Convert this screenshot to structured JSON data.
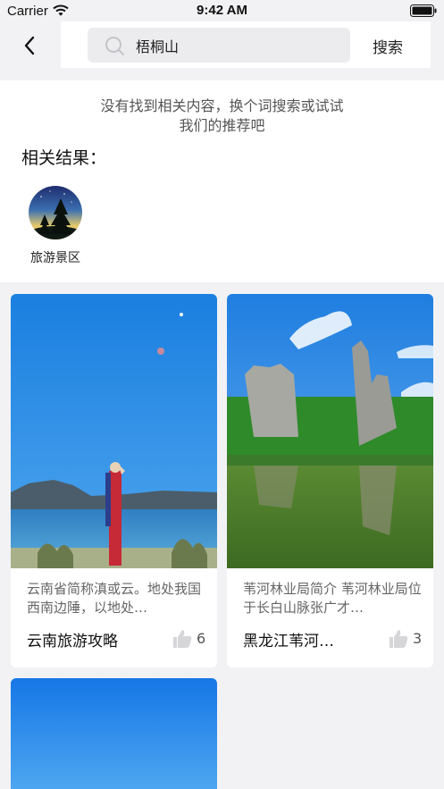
{
  "status_bar": {
    "carrier": "Carrier",
    "time": "9:42 AM"
  },
  "header": {
    "search": {
      "value": "梧桐山"
    },
    "search_button_label": "搜索"
  },
  "empty_state": {
    "line1": "没有找到相关内容，换个词搜索或试试",
    "line2": "我们的推荐吧"
  },
  "related": {
    "title": "相关结果：",
    "items": [
      {
        "label": "旅游景区",
        "icon": "tree-night-landscape-icon"
      }
    ]
  },
  "cards": [
    {
      "description": "云南省简称滇或云。地处我国西南边陲，以地处…",
      "title": "云南旅游攻略",
      "likes": "6"
    },
    {
      "description": "苇河林业局简介 苇河林业局位于长白山脉张广才…",
      "title": "黑龙江苇河…",
      "likes": "3"
    }
  ],
  "colors": {
    "background": "#f2f2f4",
    "card": "#ffffff",
    "search_box": "#ececef"
  }
}
